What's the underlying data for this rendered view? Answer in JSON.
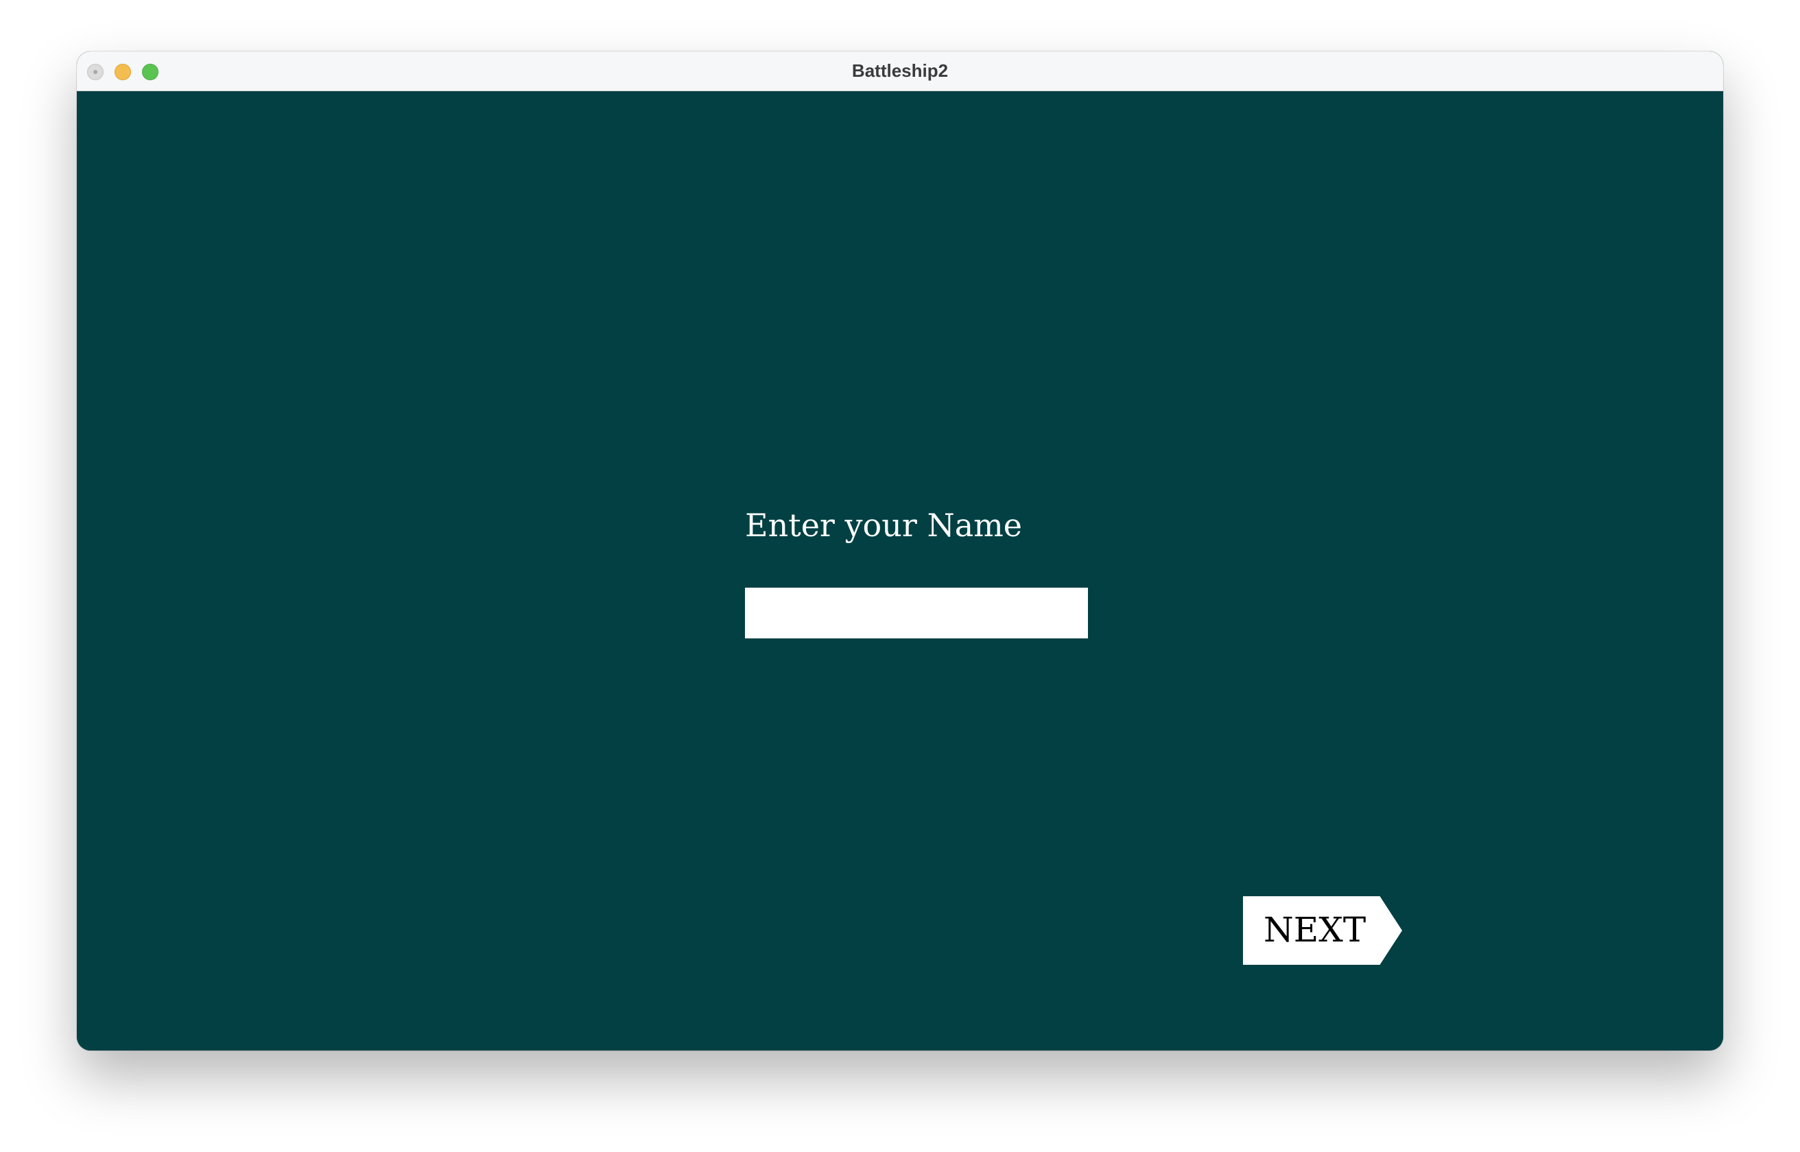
{
  "window": {
    "title": "Battleship2"
  },
  "colors": {
    "background": "#024043",
    "text": "#ffffff",
    "titlebar": "#f5f7f8",
    "button_fill": "#ffffff"
  },
  "form": {
    "name_label": "Enter your Name",
    "name_value": "",
    "name_placeholder": ""
  },
  "navigation": {
    "next_label": "NEXT",
    "next_icon": "arrow-right-shape"
  }
}
